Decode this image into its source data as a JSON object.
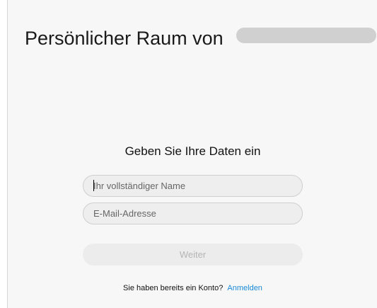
{
  "header": {
    "title": "Persönlicher Raum von"
  },
  "form": {
    "heading": "Geben Sie Ihre Daten ein",
    "name_placeholder": "Ihr vollständiger Name",
    "email_placeholder": "E-Mail-Adresse",
    "continue_label": "Weiter",
    "account_prompt": "Sie haben bereits ein Konto?",
    "signin_label": "Anmelden"
  },
  "colors": {
    "link": "#1a8ad6",
    "field_background": "#eeeeee",
    "page_background": "#f7f7f7"
  }
}
